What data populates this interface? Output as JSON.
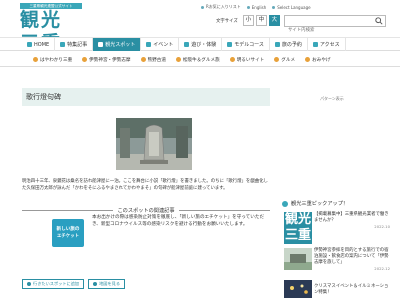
{
  "header": {
    "logo_tag": "三重県観光連盟公式サイト",
    "logo": "観光三重",
    "top_links": [
      "Rお気に入りリスト",
      "English",
      "Select Language"
    ],
    "font_size_label": "文字サイズ",
    "font_sizes": [
      "小",
      "中",
      "大"
    ],
    "search_placeholder": "サイト内検索"
  },
  "nav": {
    "items": [
      {
        "label": "HOME"
      },
      {
        "label": "特集記事"
      },
      {
        "label": "観光スポット",
        "active": true
      },
      {
        "label": "イベント"
      },
      {
        "label": "遊び・体験"
      },
      {
        "label": "モデルコース"
      },
      {
        "label": "旅の予約"
      },
      {
        "label": "アクセス"
      }
    ]
  },
  "subnav": {
    "items": [
      "はやわかり三重",
      "伊勢神宮・伊勢志摩",
      "熊野古道",
      "松阪牛＆グルメ旅",
      "明るいサイト",
      "グルメ",
      "おみやげ"
    ]
  },
  "page": {
    "title": "歌行燈句碑",
    "breadcrumb": "パターン表示",
    "description": "明治四十三年、泉鏡花は桑名を訪れ船津屋に一泊。ここを舞台に小説「歌行燈」を書きました。のちに「歌行燈」を戯曲化した久保田万太郎が詠んだ「かわをそにふるやまされてかわやまそ」の句碑が船津屋前庭に建っています。"
  },
  "related": {
    "heading": "このスポットの関連記事",
    "card_line1": "新しい旅の",
    "card_line2": "エチケット",
    "text": "本お出かけの際は感染防止対策を徹底し、「新しい旅のエチケット」を守っていただき、新型コロナウイルス等の感染リスクを避ける行動をお願いいたします。"
  },
  "bottom_buttons": [
    "行きたいスポットに追加",
    "地図を見る"
  ],
  "sidebar": {
    "pickup_title": "観光三重ピックアップ！",
    "logo": "観光三重",
    "items": [
      {
        "text": "【掲載募集中】三重県観光業者で働きませんか？",
        "date": "2022.10"
      },
      {
        "text": "伊勢神宮参拝を目的とする旅行での宿泊施設・飲食店の案内について「伊勢志摩を旅して」",
        "date": "2022.12"
      },
      {
        "text": "クリスマスイベント＆イルミネーション特集！",
        "date": ""
      }
    ]
  },
  "colors": {
    "brand": "#2a8fa3",
    "title_bg": "#e6f1ef",
    "etiquette": "#2a9fc1"
  }
}
